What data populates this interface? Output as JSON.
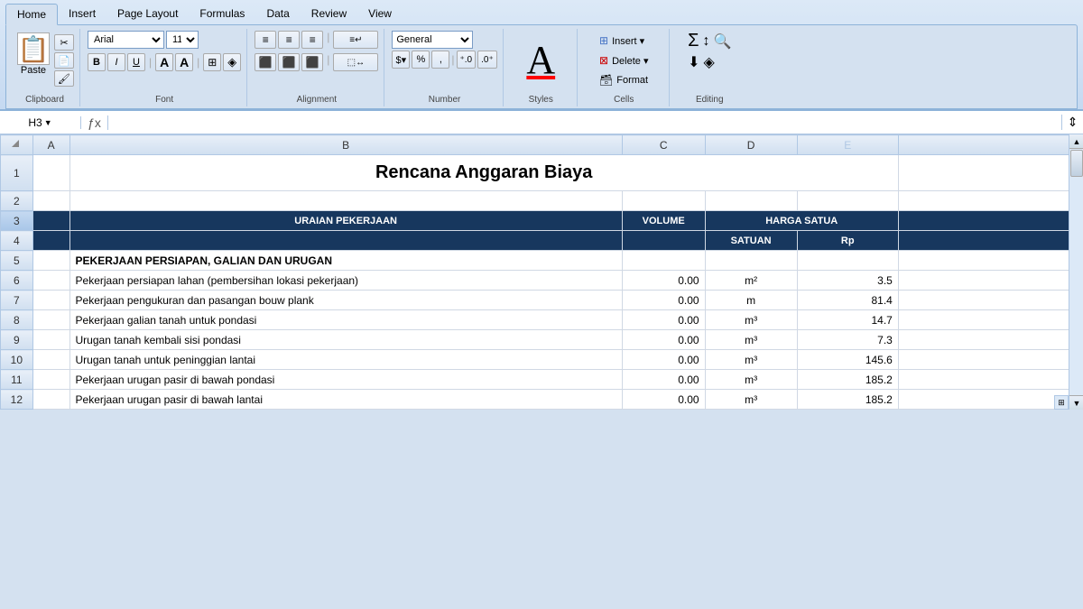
{
  "ribbon": {
    "tabs": [
      "Home",
      "Insert",
      "Page Layout",
      "Formulas",
      "Data",
      "Review",
      "View"
    ],
    "active_tab": "Home",
    "groups": {
      "clipboard": {
        "label": "Clipboard",
        "paste_label": "Paste",
        "buttons": [
          "📋",
          "✂️",
          "📄",
          "🖌️"
        ]
      },
      "font": {
        "label": "Font",
        "font_name": "Arial",
        "font_size": "11",
        "bold": "B",
        "italic": "I",
        "underline": "U",
        "increase_size": "A",
        "decrease_size": "A"
      },
      "alignment": {
        "label": "Alignment"
      },
      "number": {
        "label": "Number",
        "format": "General"
      },
      "styles": {
        "label": "Styles"
      },
      "cells": {
        "label": "Cells",
        "insert": "Insert",
        "delete": "Delete",
        "format": "Format"
      },
      "editing": {
        "label": "Editing"
      }
    }
  },
  "formula_bar": {
    "cell_ref": "H3",
    "formula_icon": "ƒx",
    "value": ""
  },
  "spreadsheet": {
    "title": "Rencana Anggaran Biaya",
    "col_headers": [
      "A",
      "B",
      "C",
      "D",
      "E"
    ],
    "headers": {
      "col_b": "URAIAN PEKERJAAN",
      "col_c": "VOLUME",
      "col_d_top": "HARGA SATUA",
      "col_d": "SATUAN",
      "col_e": "Rp"
    },
    "rows": [
      {
        "num": 1,
        "b": "Rencana Anggaran Biaya",
        "c": "",
        "d": "",
        "e": "",
        "is_title": true
      },
      {
        "num": 2,
        "b": "",
        "c": "",
        "d": "",
        "e": ""
      },
      {
        "num": 3,
        "b": "URAIAN PEKERJAAN",
        "c": "VOLUME",
        "d": "SATUAN",
        "e": "Rp",
        "is_header": true
      },
      {
        "num": 4,
        "b": "",
        "c": "",
        "d": "SATUAN",
        "e": "Rp",
        "is_sub_header": true
      },
      {
        "num": 5,
        "b": "PEKERJAAN PERSIAPAN, GALIAN DAN URUGAN",
        "c": "",
        "d": "",
        "e": "",
        "is_section": true
      },
      {
        "num": 6,
        "b": "Pekerjaan persiapan lahan (pembersihan lokasi pekerjaan)",
        "c": "0.00",
        "d": "m²",
        "e": "3.5"
      },
      {
        "num": 7,
        "b": "Pekerjaan pengukuran dan pasangan bouw plank",
        "c": "0.00",
        "d": "m",
        "e": "81.4"
      },
      {
        "num": 8,
        "b": "Pekerjaan galian tanah untuk pondasi",
        "c": "0.00",
        "d": "m³",
        "e": "14.7"
      },
      {
        "num": 9,
        "b": "Urugan tanah kembali sisi pondasi",
        "c": "0.00",
        "d": "m³",
        "e": "7.3"
      },
      {
        "num": 10,
        "b": "Urugan tanah untuk peninggian lantai",
        "c": "0.00",
        "d": "m³",
        "e": "145.6"
      },
      {
        "num": 11,
        "b": "Pekerjaan urugan pasir di bawah pondasi",
        "c": "0.00",
        "d": "m³",
        "e": "185.2"
      },
      {
        "num": 12,
        "b": "Pekerjaan urugan pasir di bawah lantai",
        "c": "0.00",
        "d": "m³",
        "e": "185.2"
      }
    ]
  }
}
